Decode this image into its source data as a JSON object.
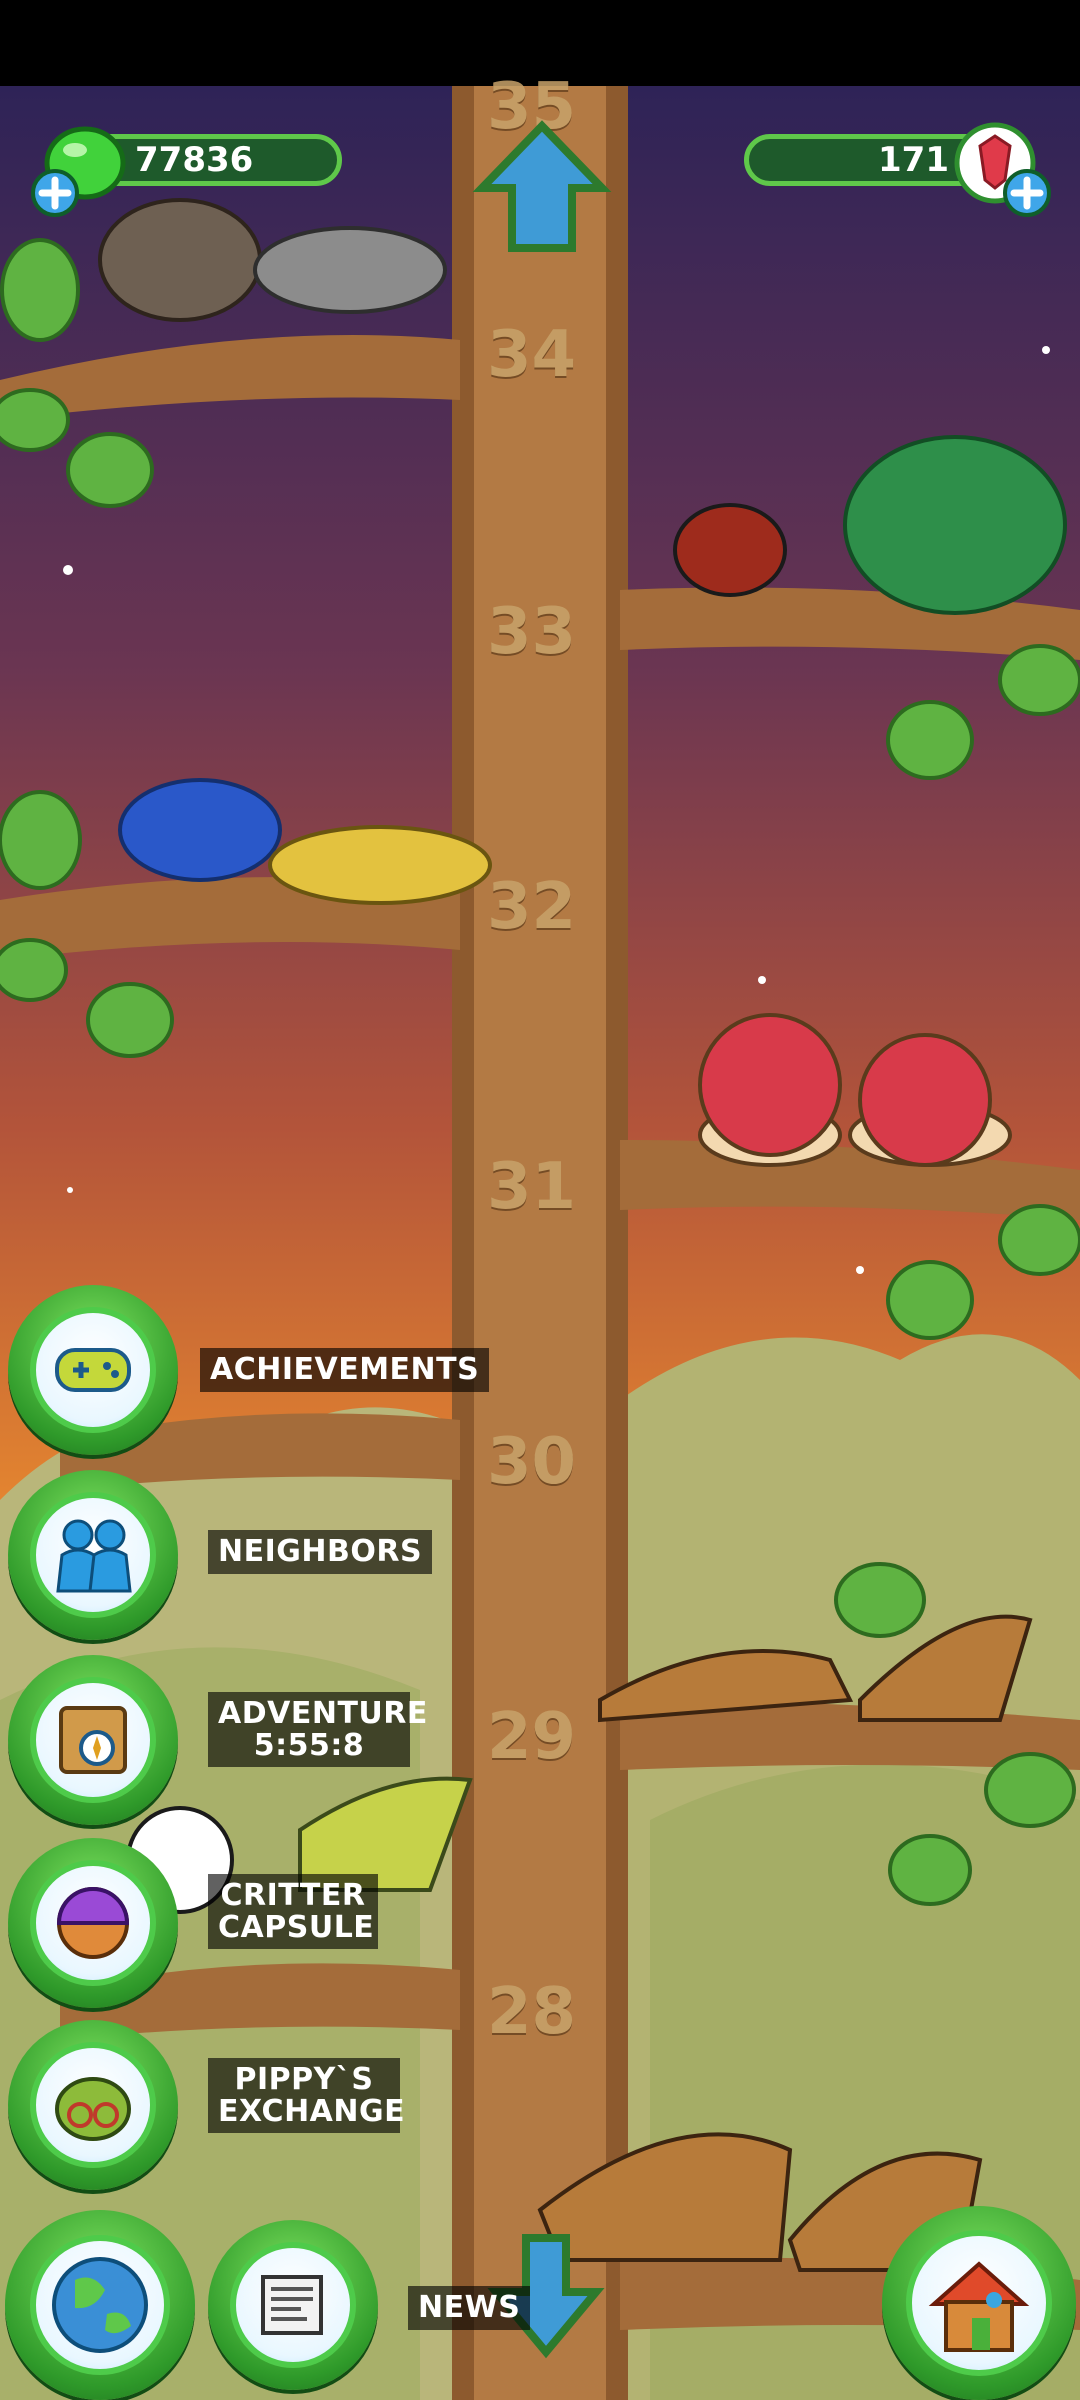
{
  "hud": {
    "coins_value": "77836",
    "gems_value": "171"
  },
  "tree_levels": [
    "35",
    "34",
    "33",
    "32",
    "31",
    "30",
    "29",
    "28"
  ],
  "menu": {
    "achievements": "ACHIEVEMENTS",
    "neighbors": "NEIGHBORS",
    "adventure_line1": "ADVENTURE",
    "adventure_timer": "5:55:8",
    "critter_line1": "CRITTER",
    "critter_line2": "CAPSULE",
    "pippy_line1": "PIPPY`S",
    "pippy_line2": "EXCHANGE",
    "news": "NEWS"
  },
  "colors": {
    "sky_top": "#3b2a5c",
    "sky_mid": "#b3543a",
    "sky_low": "#e6872f",
    "trunk": "#b37a44",
    "leaf": "#5fb342",
    "button_green": "#3fae33"
  }
}
